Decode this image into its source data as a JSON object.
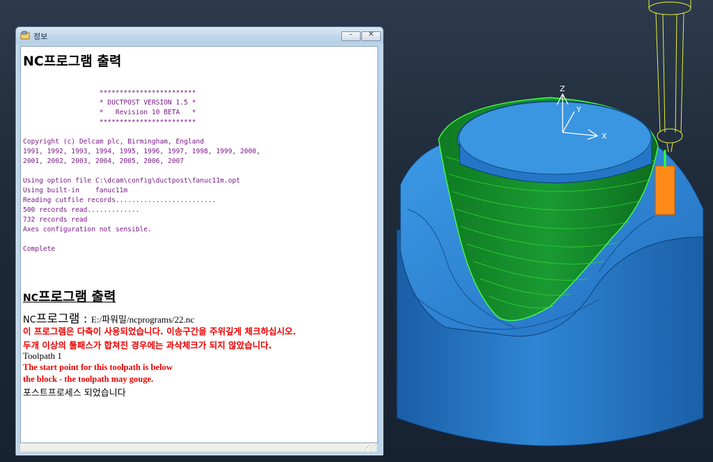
{
  "window": {
    "title": "정보",
    "min_glyph": "–",
    "close_glyph": "✕"
  },
  "report": {
    "heading": "NC프로그램 출력",
    "banner": [
      "                   ************************",
      "                   * DUCTPOST VERSION 1.5 *",
      "                   *   Revision 10 BETA   *",
      "                   ************************"
    ],
    "copyright": [
      "Copyright (c) Delcam plc, Birmingham, England",
      "1991, 1992, 1993, 1994, 1995, 1996, 1997, 1998, 1999, 2000,",
      "2001, 2002, 2003, 2004, 2005, 2006, 2007"
    ],
    "log": [
      "Using option file C:\\dcam\\config\\ductpost\\fanuc11m.opt",
      "Using built-in    fanuc11m",
      "Reading cutfile records.........................",
      "500 records read.............",
      "732 records read",
      "Axes configuration not sensible."
    ],
    "complete": "Complete",
    "section_title_prefix": "NC",
    "section_title": "프로그램 출력",
    "nc_label_prefix": "NC",
    "nc_label": "프로그램 : ",
    "nc_path": "E:/파워밀/ncprograms/22.nc",
    "warning_1": "이 프로그램은 다축이 사용되었습니다. 이송구간을 주위깊게 체크하십시오.",
    "warning_2": " 두개 이상의 툴패스가 합쳐진 경우에는 과삭체크가 되지 않았습니다.",
    "toolpath": "Toolpath 1",
    "gouge_1": "The start point for this toolpath is below",
    "gouge_2": "the block - the toolpath may gouge.",
    "postprocessed": "포스트프로세스 되었습니다"
  },
  "viewport": {
    "axis_x": "X",
    "axis_y": "Y",
    "axis_z": "Z",
    "colors": {
      "part": "#2f86d4",
      "toolpath": "#22dd22",
      "tool": "#e7ef3a",
      "holder": "#ff8a18"
    }
  }
}
